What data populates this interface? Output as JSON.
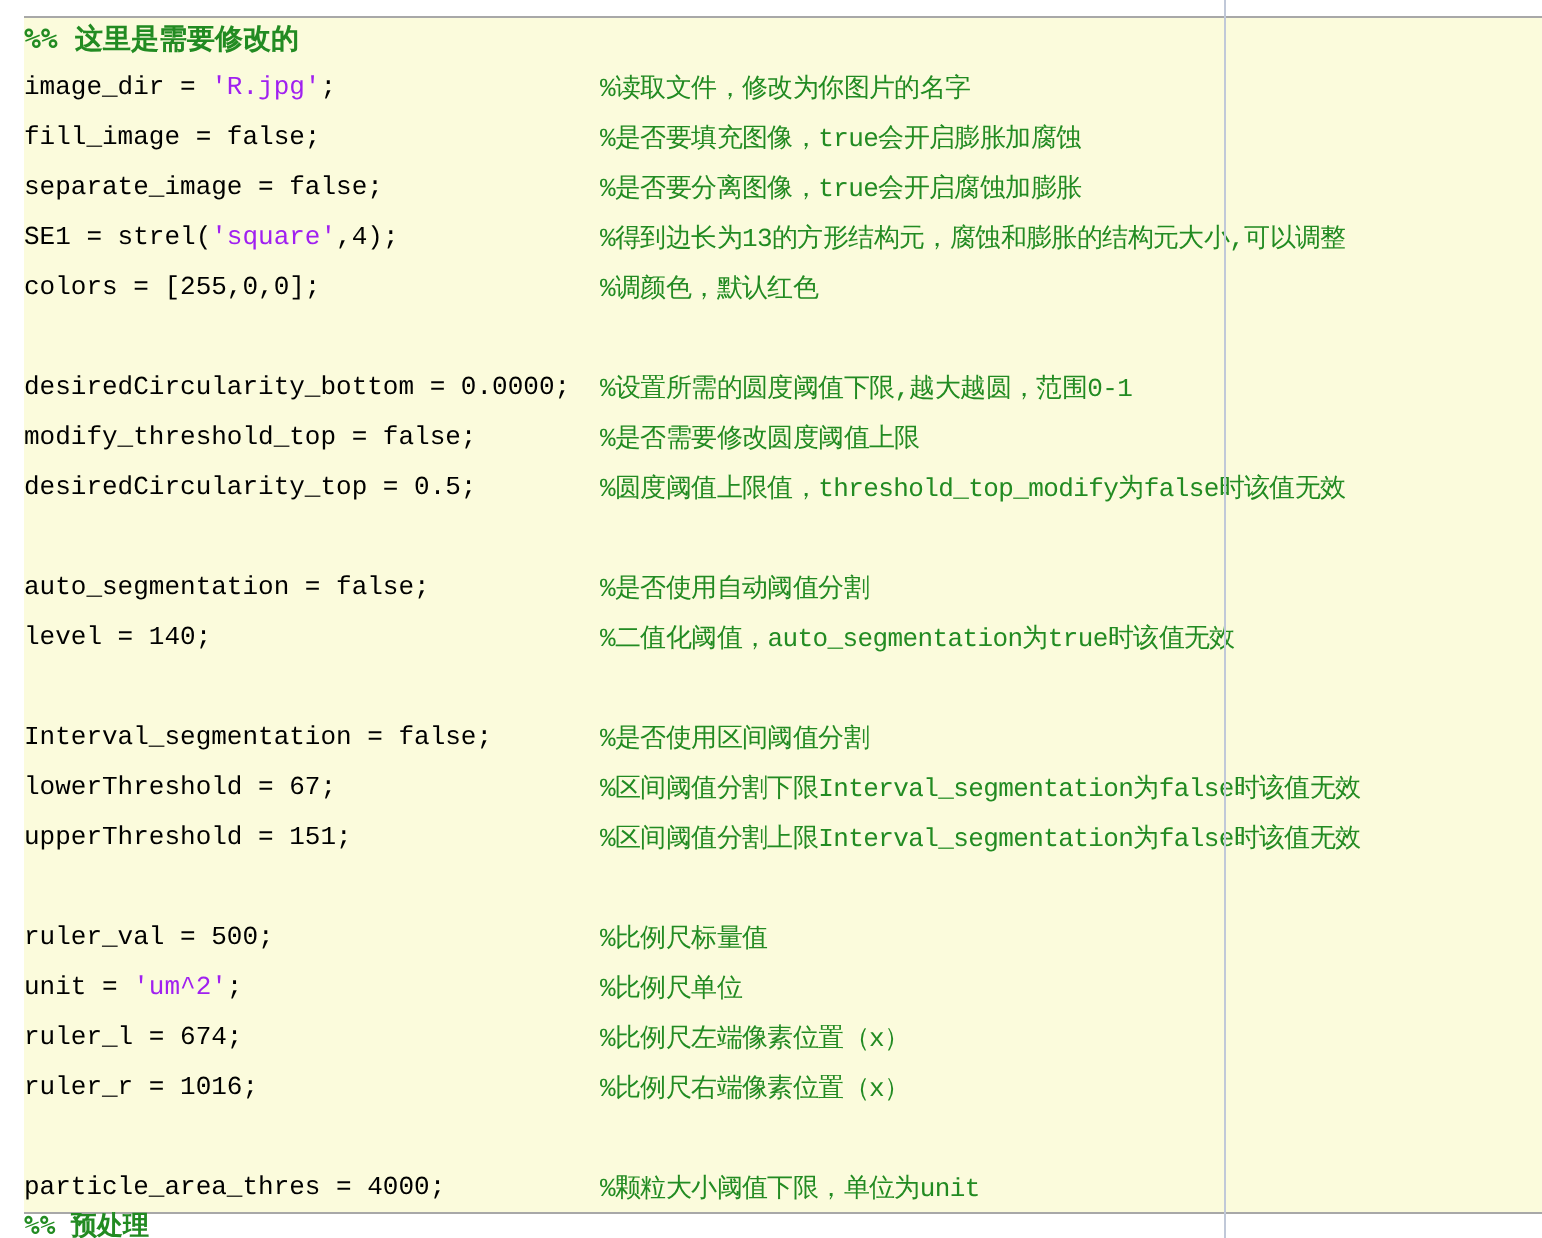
{
  "cell_title": "%% 这里是需要修改的",
  "lines": [
    {
      "kind": "code",
      "code": [
        {
          "kind": "plain",
          "text": "image_dir = "
        },
        {
          "kind": "string",
          "text": "'R.jpg'"
        },
        {
          "kind": "plain",
          "text": ";"
        }
      ],
      "comment": "%读取文件，修改为你图片的名字"
    },
    {
      "kind": "code",
      "code": [
        {
          "kind": "plain",
          "text": "fill_image = false;"
        }
      ],
      "comment": "%是否要填充图像，true会开启膨胀加腐蚀"
    },
    {
      "kind": "code",
      "code": [
        {
          "kind": "plain",
          "text": "separate_image = false;"
        }
      ],
      "comment": "%是否要分离图像，true会开启腐蚀加膨胀"
    },
    {
      "kind": "code",
      "code": [
        {
          "kind": "plain",
          "text": "SE1 = strel("
        },
        {
          "kind": "string",
          "text": "'square'"
        },
        {
          "kind": "plain",
          "text": ",4);"
        }
      ],
      "comment": "%得到边长为13的方形结构元，腐蚀和膨胀的结构元大小,可以调整"
    },
    {
      "kind": "code",
      "code": [
        {
          "kind": "plain",
          "text": "colors = [255,0,0];"
        }
      ],
      "comment": "%调颜色，默认红色"
    },
    {
      "kind": "blank"
    },
    {
      "kind": "code",
      "code": [
        {
          "kind": "plain",
          "text": "desiredCircularity_bottom = 0.0000;"
        }
      ],
      "comment": "%设置所需的圆度阈值下限,越大越圆，范围0-1"
    },
    {
      "kind": "code",
      "code": [
        {
          "kind": "plain",
          "text": "modify_threshold_top = false;"
        }
      ],
      "comment": "%是否需要修改圆度阈值上限"
    },
    {
      "kind": "code",
      "code": [
        {
          "kind": "plain",
          "text": "desiredCircularity_top = 0.5;"
        }
      ],
      "comment": "%圆度阈值上限值，threshold_top_modify为false时该值无效"
    },
    {
      "kind": "blank"
    },
    {
      "kind": "code",
      "code": [
        {
          "kind": "plain",
          "text": "auto_segmentation = false;"
        }
      ],
      "comment": "%是否使用自动阈值分割"
    },
    {
      "kind": "code",
      "code": [
        {
          "kind": "plain",
          "text": "level = 140;"
        }
      ],
      "comment": "%二值化阈值，auto_segmentation为true时该值无效"
    },
    {
      "kind": "blank"
    },
    {
      "kind": "code",
      "code": [
        {
          "kind": "plain",
          "text": "Interval_segmentation = false;"
        }
      ],
      "comment": "%是否使用区间阈值分割"
    },
    {
      "kind": "code",
      "code": [
        {
          "kind": "plain",
          "text": "lowerThreshold = 67;"
        }
      ],
      "comment": "%区间阈值分割下限Interval_segmentation为false时该值无效"
    },
    {
      "kind": "code",
      "code": [
        {
          "kind": "plain",
          "text": "upperThreshold = 151;"
        }
      ],
      "comment": "%区间阈值分割上限Interval_segmentation为false时该值无效"
    },
    {
      "kind": "blank"
    },
    {
      "kind": "code",
      "code": [
        {
          "kind": "plain",
          "text": "ruler_val = 500;"
        }
      ],
      "comment": "%比例尺标量值"
    },
    {
      "kind": "code",
      "code": [
        {
          "kind": "plain",
          "text": "unit = "
        },
        {
          "kind": "string",
          "text": "'um^2'"
        },
        {
          "kind": "plain",
          "text": ";"
        }
      ],
      "comment": "%比例尺单位"
    },
    {
      "kind": "code",
      "code": [
        {
          "kind": "plain",
          "text": "ruler_l = 674;"
        }
      ],
      "comment": "%比例尺左端像素位置（x）"
    },
    {
      "kind": "code",
      "code": [
        {
          "kind": "plain",
          "text": "ruler_r = 1016;"
        }
      ],
      "comment": "%比例尺右端像素位置（x）"
    },
    {
      "kind": "blank"
    },
    {
      "kind": "code",
      "code": [
        {
          "kind": "plain",
          "text": "particle_area_thres = 4000;"
        }
      ],
      "comment": "%颗粒大小阈值下限，单位为unit"
    }
  ],
  "next_cell_title": "%% 预处理"
}
